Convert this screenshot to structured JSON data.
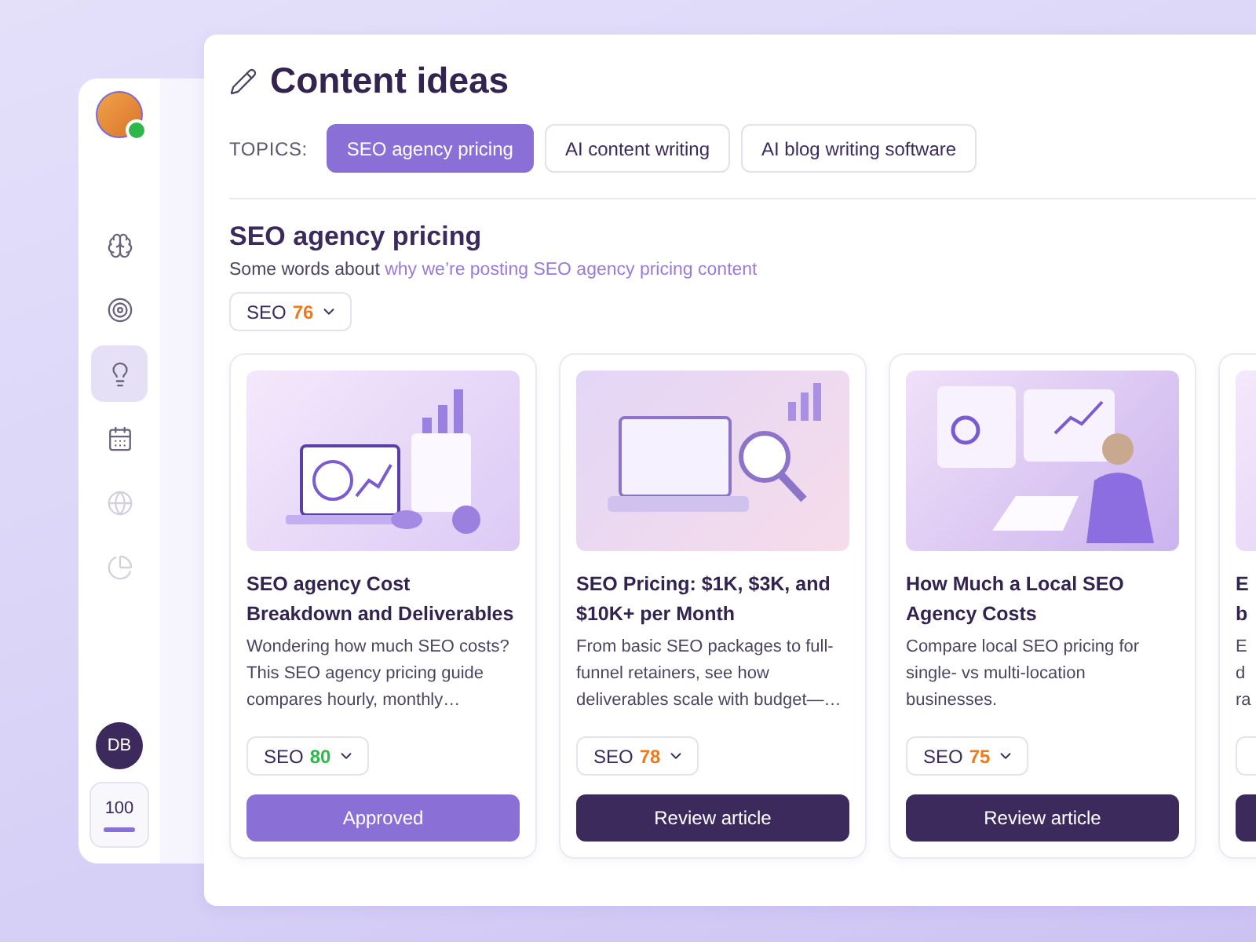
{
  "sidebar": {
    "nav": [
      {
        "kind": "brain",
        "selected": false,
        "disabled": false
      },
      {
        "kind": "target",
        "selected": false,
        "disabled": false
      },
      {
        "kind": "bulb",
        "selected": true,
        "disabled": false
      },
      {
        "kind": "calendar",
        "selected": false,
        "disabled": false
      },
      {
        "kind": "globe",
        "selected": false,
        "disabled": true
      },
      {
        "kind": "pie",
        "selected": false,
        "disabled": true
      }
    ],
    "user_initials": "DB",
    "credits": "100"
  },
  "title": "Content ideas",
  "topics": {
    "label": "TOPICS:",
    "items": [
      {
        "label": "SEO agency pricing",
        "selected": true
      },
      {
        "label": "AI content writing",
        "selected": false
      },
      {
        "label": "AI blog writing software",
        "selected": false
      }
    ]
  },
  "section": {
    "heading": "SEO agency pricing",
    "description": "Some words about ",
    "link": "why we’re posting SEO agency pricing content",
    "seo_label": "SEO",
    "seo_score": "76",
    "color": "#f07a1a"
  },
  "cards": [
    {
      "kind": "seo",
      "title": "SEO agency Cost Breakdown and Deliverables",
      "description": "Wondering how much SEO costs? This SEO agency pricing guide compares hourly, monthly…",
      "seo_label": "SEO",
      "seo_score": "80",
      "color": "#2fb84a",
      "button": {
        "kind": "approved",
        "label": "Approved"
      }
    },
    {
      "kind": "laptop",
      "title": "SEO Pricing: $1K, $3K, and $10K+ per Month",
      "description": "From basic SEO packages to full-funnel retainers, see how deliverables scale with budget—…",
      "seo_label": "SEO",
      "seo_score": "78",
      "color": "#f07a1a",
      "button": {
        "kind": "review",
        "label": "Review article"
      }
    },
    {
      "kind": "person",
      "title": "How Much a Local SEO Agency Costs",
      "description": "Compare local SEO pricing for single- vs multi-location businesses.",
      "seo_label": "SEO",
      "seo_score": "75",
      "color": "#f07a1a",
      "button": {
        "kind": "review",
        "label": "Review article"
      }
    }
  ],
  "cut_card": {
    "title_lines": [
      "E",
      "b"
    ],
    "description_lines": [
      "E",
      "d",
      "ra"
    ]
  }
}
